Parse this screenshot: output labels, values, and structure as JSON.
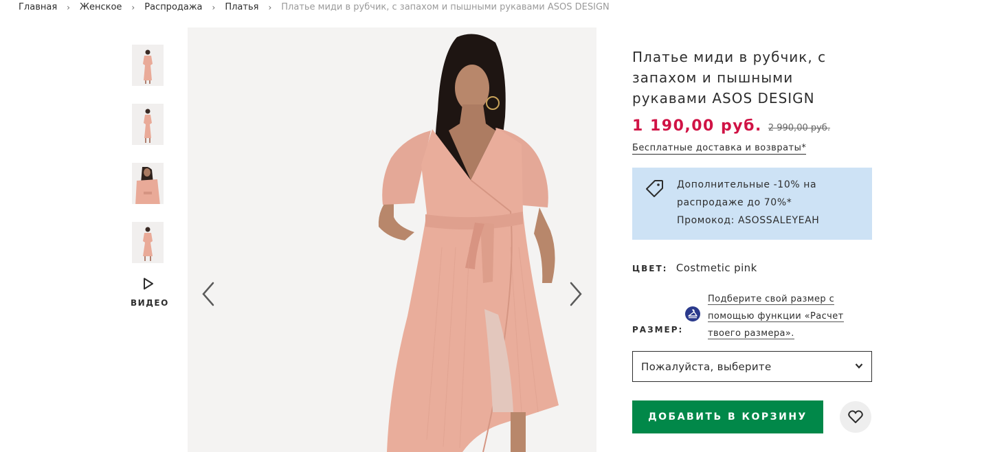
{
  "breadcrumb": {
    "items": [
      "Главная",
      "Женское",
      "Распродажа",
      "Платья"
    ],
    "current": "Платье миди в рубчик, с запахом и пышными рукавами ASOS DESIGN",
    "separator": "›"
  },
  "gallery": {
    "thumbnail_count": 4,
    "video_label": "ВИДЕО"
  },
  "product": {
    "title": "Платье миди в рубчик, с запахом и пышными рукавами ASOS DESIGN",
    "price": "1 190,00 руб.",
    "old_price": "2 990,00 руб.",
    "delivery_link": "Бесплатные доставка и возвраты*"
  },
  "promo": {
    "line1": "Дополнительные -10% на",
    "line2": "распродаже до 70%*",
    "line3": "Промокод: ASOSSALEYEAH"
  },
  "color": {
    "label": "ЦВЕТ:",
    "value": "Costmetic pink"
  },
  "size": {
    "label": "РАЗМЕР:",
    "fit_link": "Подберите свой размер с помощью функции «Расчет твоего размера».",
    "select_placeholder": "Пожалуйста, выберите"
  },
  "actions": {
    "add_to_bag": "ДОБАВИТЬ В КОРЗИНУ"
  },
  "colors": {
    "price_red": "#d01345",
    "promo_bg": "#cde2f5",
    "add_button_green": "#018849",
    "dress_pink": "#e9aa98"
  }
}
